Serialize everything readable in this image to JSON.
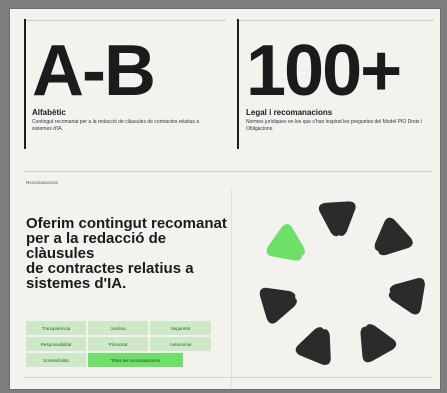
{
  "stats": [
    {
      "value": "A-B",
      "title": "Alfabètic",
      "desc": "Contingut recomanat per a la redacció de clàusules de contractes relatius a sistemes d'IA."
    },
    {
      "value": "100+",
      "title": "Legal i recomanacions",
      "desc": "Normes jurídiques en les que s'han inspirat les preguntes del Model PIO Drets i Obligacions."
    }
  ],
  "section": {
    "label": "Recomanacions",
    "headline": "Oferim contingut recomanat\nper a la redacció de clàusules\nde contractes relatius a\nsistemes d'IA."
  },
  "tags": [
    [
      "Transparència",
      "Justícia",
      "Seguretat"
    ],
    [
      "Responsabilitat",
      "Privacitat",
      "Autonomia"
    ],
    [
      "Sostenibilitat",
      "Totes les recomanacions"
    ]
  ],
  "colors": {
    "accent": "#6ee06a",
    "tag_bg": "#cfe9c8",
    "dark": "#2b2b2b"
  },
  "wheel_highlight": 0
}
